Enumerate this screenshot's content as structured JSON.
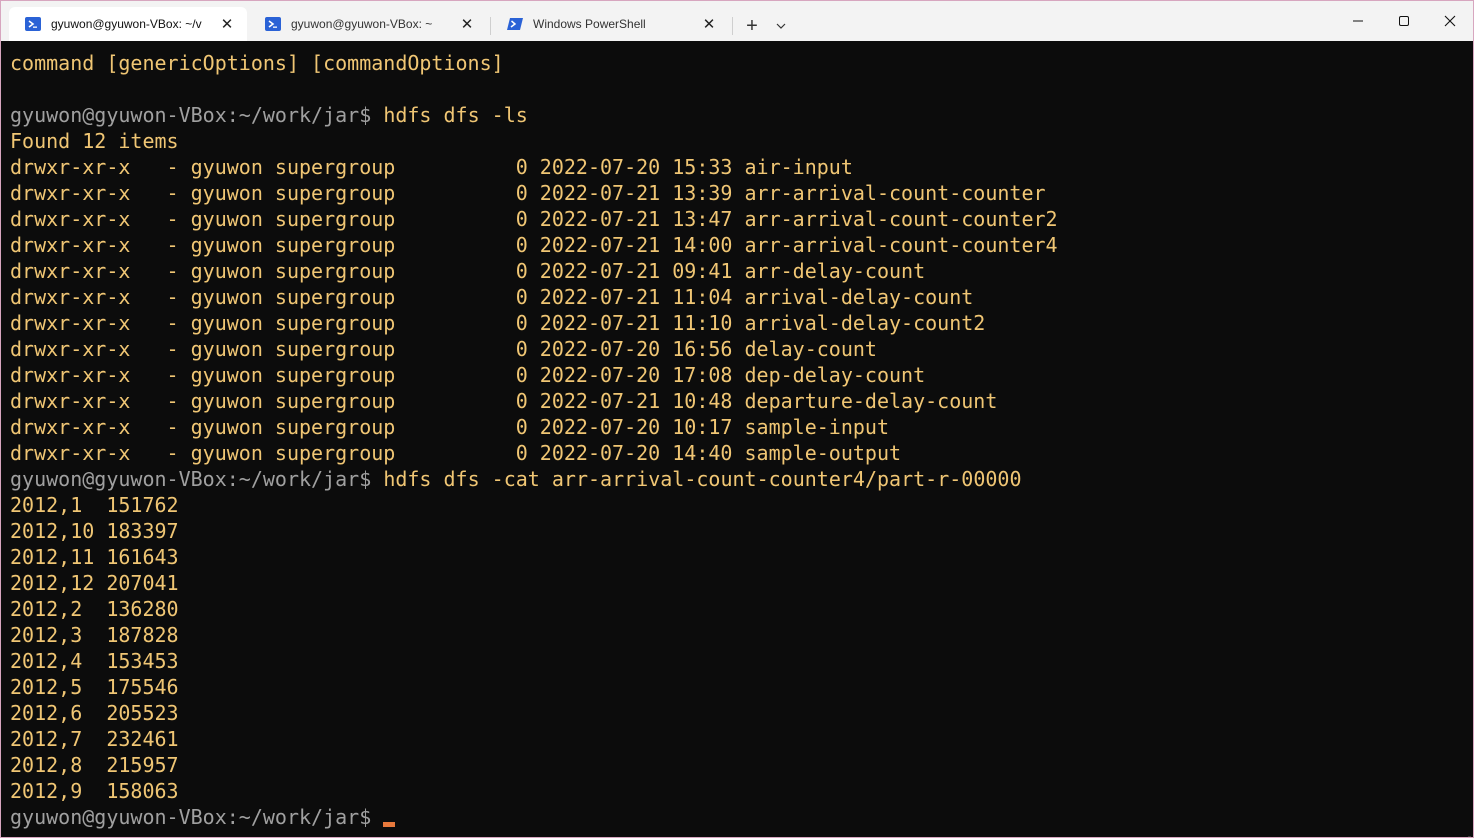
{
  "tabs": [
    {
      "label": "gyuwon@gyuwon-VBox: ~/v",
      "icon": "terminal-prompt-icon",
      "active": true
    },
    {
      "label": "gyuwon@gyuwon-VBox: ~",
      "icon": "terminal-prompt-icon",
      "active": false
    },
    {
      "label": "Windows PowerShell",
      "icon": "powershell-icon",
      "active": false
    }
  ],
  "window_controls": {
    "minimize": "minimize-icon",
    "maximize": "maximize-icon",
    "close": "close-icon"
  },
  "colors": {
    "text": "#f0c674",
    "prompt": "#a0a0a0",
    "background": "#0c0c0c",
    "cursor": "#e8793c"
  },
  "terminal": {
    "top_line": "command [genericOptions] [commandOptions]",
    "prompt": {
      "user": "gyuwon@gyuwon-VBox",
      "sep": ":",
      "path": "~/work/jar",
      "symbol": "$ "
    },
    "cmd1": "hdfs dfs -ls",
    "found": "Found 12 items",
    "ls_rows": [
      "drwxr-xr-x   - gyuwon supergroup          0 2022-07-20 15:33 air-input",
      "drwxr-xr-x   - gyuwon supergroup          0 2022-07-21 13:39 arr-arrival-count-counter",
      "drwxr-xr-x   - gyuwon supergroup          0 2022-07-21 13:47 arr-arrival-count-counter2",
      "drwxr-xr-x   - gyuwon supergroup          0 2022-07-21 14:00 arr-arrival-count-counter4",
      "drwxr-xr-x   - gyuwon supergroup          0 2022-07-21 09:41 arr-delay-count",
      "drwxr-xr-x   - gyuwon supergroup          0 2022-07-21 11:04 arrival-delay-count",
      "drwxr-xr-x   - gyuwon supergroup          0 2022-07-21 11:10 arrival-delay-count2",
      "drwxr-xr-x   - gyuwon supergroup          0 2022-07-20 16:56 delay-count",
      "drwxr-xr-x   - gyuwon supergroup          0 2022-07-20 17:08 dep-delay-count",
      "drwxr-xr-x   - gyuwon supergroup          0 2022-07-21 10:48 departure-delay-count",
      "drwxr-xr-x   - gyuwon supergroup          0 2022-07-20 10:17 sample-input",
      "drwxr-xr-x   - gyuwon supergroup          0 2022-07-20 14:40 sample-output"
    ],
    "cmd2": "hdfs dfs -cat arr-arrival-count-counter4/part-r-00000",
    "cat_rows": [
      "2012,1  151762",
      "2012,10 183397",
      "2012,11 161643",
      "2012,12 207041",
      "2012,2  136280",
      "2012,3  187828",
      "2012,4  153453",
      "2012,5  175546",
      "2012,6  205523",
      "2012,7  232461",
      "2012,8  215957",
      "2012,9  158063"
    ]
  }
}
